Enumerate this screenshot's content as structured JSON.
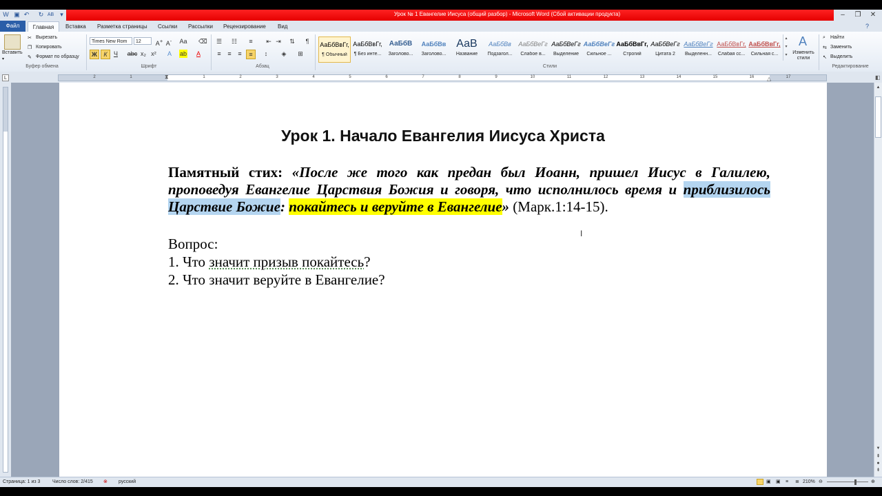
{
  "window": {
    "title": "Урок № 1 Евангелие Иисуса (общий разбор)  -  Microsoft Word (Сбой активации продукта)"
  },
  "quick_access": [
    "word-icon",
    "save-icon",
    "undo-icon",
    "redo-icon",
    "spellcheck-icon"
  ],
  "tabs": [
    "Файл",
    "Главная",
    "Вставка",
    "Разметка страницы",
    "Ссылки",
    "Рассылки",
    "Рецензирование",
    "Вид"
  ],
  "ribbon": {
    "clipboard": {
      "paste": "Вставить",
      "cut": "Вырезать",
      "copy": "Копировать",
      "format_painter": "Формат по образцу",
      "label": "Буфер обмена"
    },
    "font": {
      "name": "Times New Rom",
      "size": "12",
      "label": "Шрифт",
      "bold": "Ж",
      "italic": "К",
      "underline": "Ч",
      "strike": "abc",
      "sub": "x₂",
      "sup": "x²"
    },
    "paragraph": {
      "label": "Абзац"
    },
    "styles": {
      "label": "Стили",
      "items": [
        {
          "preview": "АаБбВвГг,",
          "name": "¶ Обычный"
        },
        {
          "preview": "АаБбВвГг,",
          "name": "¶ Без инте..."
        },
        {
          "preview": "АаБбВ",
          "name": "Заголово..."
        },
        {
          "preview": "АаБбВв",
          "name": "Заголово..."
        },
        {
          "preview": "АаВ",
          "name": "Название"
        },
        {
          "preview": "АаБбВв",
          "name": "Подзагол..."
        },
        {
          "preview": "АаБбВеГг",
          "name": "Слабое в..."
        },
        {
          "preview": "АаБбВеГг",
          "name": "Выделение"
        },
        {
          "preview": "АаБбВеГг",
          "name": "Сильное ..."
        },
        {
          "preview": "АаБбВвГг,",
          "name": "Строгий"
        },
        {
          "preview": "АаБбВеГг",
          "name": "Цитата 2"
        },
        {
          "preview": "АаБбВеГг",
          "name": "Выделенн..."
        },
        {
          "preview": "АаБбВвГг,",
          "name": "Слабая сс..."
        },
        {
          "preview": "АаБбВвГг,",
          "name": "Сильная с..."
        }
      ],
      "change_styles": "Изменить стили"
    },
    "editing": {
      "find": "Найти",
      "replace": "Заменить",
      "select": "Выделить",
      "label": "Редактирование"
    }
  },
  "ruler_numbers": [
    "2",
    "1",
    "1",
    "2",
    "3",
    "4",
    "5",
    "6",
    "7",
    "8",
    "9",
    "10",
    "11",
    "12",
    "13",
    "14",
    "15",
    "16",
    "17"
  ],
  "document": {
    "title": "Урок 1. Начало Евангелия Иисуса Христа",
    "verse_label": "Памятный стих:",
    "verse_part1": "«После же того как предан был Иоанн, пришел Иисус в Галилею, проповедуя Евангелие Царствия Божия и говоря, что исполнилось время и ",
    "verse_hl_blue": "приблизилось Царствие Божие",
    "verse_colon": ": ",
    "verse_hl_yellow": "покайтесь и веруйте в Евангелие",
    "verse_end": "»",
    "verse_ref": " (Марк.1:14-15).",
    "question_label": "Вопрос:",
    "q1_prefix": "1. Что ",
    "q1_squiggle": "значит призыв покайтесь",
    "q1_suffix": "?",
    "q2": "2. Что значит веруйте в Евангелие?"
  },
  "status": {
    "page": "Страница: 1 из 3",
    "words": "Число слов: 2/415",
    "language": "русский",
    "zoom": "210%"
  }
}
